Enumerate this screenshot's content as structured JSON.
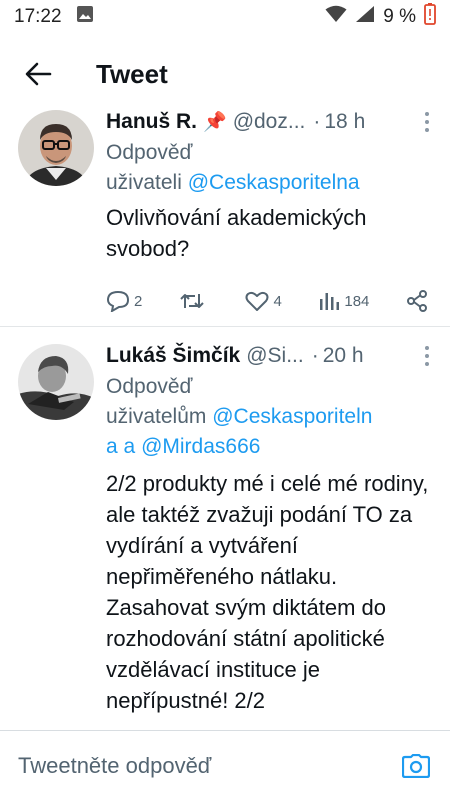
{
  "status_bar": {
    "time": "17:22",
    "battery": "9 %"
  },
  "header": {
    "title": "Tweet"
  },
  "tweets": [
    {
      "author": "Hanuš R.",
      "badge": "📌",
      "handle": "@doz...",
      "dot": "·",
      "time": "18 h",
      "reply_prefix": "Odpověď",
      "reply_users_label": "uživateli",
      "mentions": [
        "@Ceskasporitelna"
      ],
      "text": "Ovlivňování akademických svobod?",
      "stats": {
        "replies": "2",
        "retweets": "",
        "likes": "4",
        "views": "184"
      }
    },
    {
      "author": "Lukáš Šimčík",
      "handle": "@Si...",
      "dot": "·",
      "time": "20 h",
      "reply_prefix": "Odpověď",
      "reply_users_label": "uživatelům",
      "mention_1": "@Ceskasporiteln",
      "mention_1_cont": "a",
      "and_word": "a",
      "mention_2": "@Mirdas666",
      "text": "2/2 produkty mé i celé mé rodiny, ale taktéž zvažuji podání TO za vydírání a vytváření nepřiměřeného nátlaku. Zasahovat svým diktátem do rozhodování státní apolitické vzdělávací instituce je nepřípustné! 2/2"
    }
  ],
  "reply_bar": {
    "placeholder": "Tweetněte odpověď"
  },
  "colors": {
    "accent": "#1d9bf0",
    "secondary_text": "#536471",
    "battery_low": "#e0452b"
  }
}
